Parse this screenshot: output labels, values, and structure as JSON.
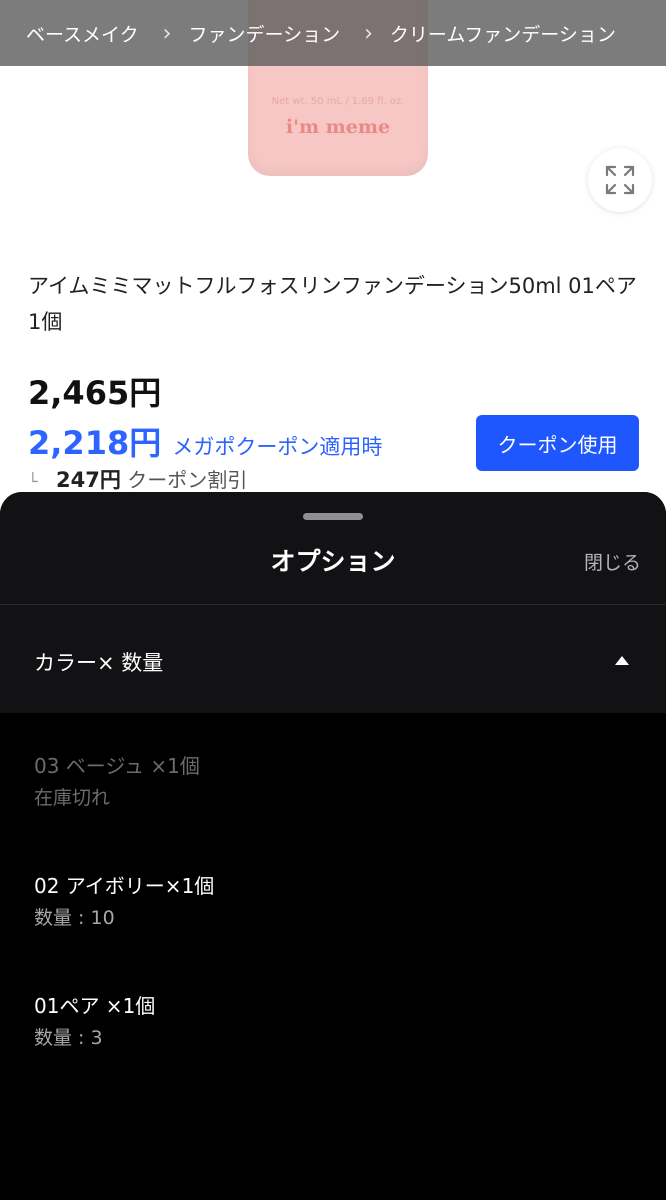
{
  "breadcrumb": [
    "ベースメイク",
    "ファンデーション",
    "クリームファンデーション"
  ],
  "product_image": {
    "brand_label": "i'm meme",
    "net_label": "Net wt. 50 mL / 1.69 fl. oz."
  },
  "product": {
    "title": "アイムミミマットフルフォスリンファンデーション50ml 01ペア1個",
    "price": "2,465円",
    "coupon_price": "2,218円",
    "coupon_note": "メガポクーポン適用時",
    "discount_mark": "└",
    "discount_amount": "247円",
    "discount_label": "クーポン割引",
    "coupon_button": "クーポン使用"
  },
  "sheet": {
    "title": "オプション",
    "close": "閉じる",
    "selector_label": "カラー× 数量",
    "options": [
      {
        "name": "03 ベージュ ×1個",
        "sub": "在庫切れ",
        "available": false
      },
      {
        "name": "02 アイボリー×1個",
        "sub": "数量 : 10",
        "available": true
      },
      {
        "name": "01ペア ×1個",
        "sub": "数量 : 3",
        "available": true
      }
    ]
  },
  "colors": {
    "accent": "#1f57ff",
    "coupon_text": "#2d63ff",
    "bottle": "#f6c7c4",
    "sheet_bg": "#000000"
  }
}
